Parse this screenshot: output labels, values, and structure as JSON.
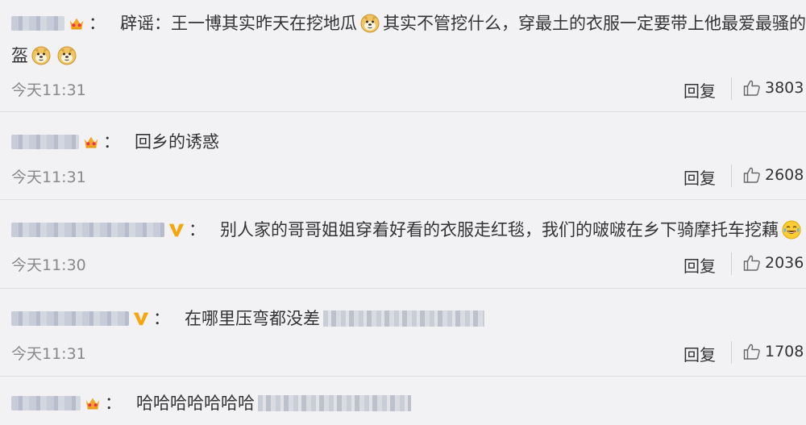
{
  "comments": [
    {
      "text_a": "辟谣：王一博其实昨天在挖地瓜",
      "text_b": "其实不管挖什么，穿最土的衣服一定要带上他最爱最骚的头",
      "text_c": "盔",
      "badge": "crown-icon",
      "time": "今天11:31",
      "reply": "回复",
      "likes": "3803"
    },
    {
      "text_a": "回乡的诱惑",
      "badge": "crown-icon",
      "time": "今天11:31",
      "reply": "回复",
      "likes": "2608"
    },
    {
      "text_a": "别人家的哥哥姐姐穿着好看的衣服走红毯，我们的啵啵在乡下骑摩托车挖藕",
      "badge": "v-verified-icon",
      "time": "今天11:30",
      "reply": "回复",
      "likes": "2036"
    },
    {
      "text_a": "在哪里压弯都没差",
      "badge": "v-verified-icon",
      "time": "今天11:31",
      "reply": "回复",
      "likes": "1708"
    },
    {
      "text_a": "哈哈哈哈哈哈哈",
      "badge": "crown-icon"
    }
  ],
  "colors": {
    "background": "#f2f2f5",
    "text": "#333333",
    "muted": "#888888",
    "crown": "#f5a623",
    "v_badge": "#f6a50d"
  }
}
